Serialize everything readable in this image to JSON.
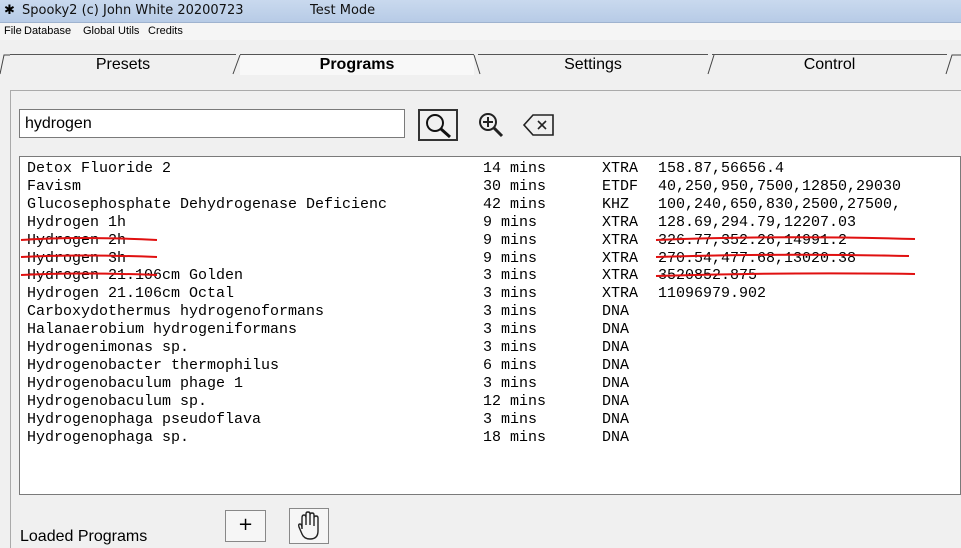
{
  "window": {
    "title": "Spooky2 (c) John White 20200723",
    "mode": "Test Mode"
  },
  "menu": [
    "File",
    "Database",
    "Global",
    "Utils",
    "Credits"
  ],
  "tabs": [
    "Presets",
    "Programs",
    "Settings",
    "Control"
  ],
  "search": {
    "value": "hydrogen"
  },
  "programs": [
    {
      "name": "Detox Fluoride 2",
      "duration": "14 mins",
      "type": "XTRA",
      "freqs": "158.87,56656.4"
    },
    {
      "name": "Favism",
      "duration": "30 mins",
      "type": "ETDF",
      "freqs": "40,250,950,7500,12850,29030"
    },
    {
      "name": "Glucosephosphate Dehydrogenase Deficienc",
      "duration": "42 mins",
      "type": "KHZ",
      "freqs": "100,240,650,830,2500,27500,"
    },
    {
      "name": "Hydrogen 1h",
      "duration": "9 mins",
      "type": "XTRA",
      "freqs": "128.69,294.79,12207.03"
    },
    {
      "name": "Hydrogen 2h",
      "duration": "9 mins",
      "type": "XTRA",
      "freqs": "326.77,352.26,14991.2"
    },
    {
      "name": "Hydrogen 3h",
      "duration": "9 mins",
      "type": "XTRA",
      "freqs": "270.54,477.68,13020.38"
    },
    {
      "name": "Hydrogen 21.106cm Golden",
      "duration": "3 mins",
      "type": "XTRA",
      "freqs": "3520852.875"
    },
    {
      "name": "Hydrogen 21.106cm Octal",
      "duration": "3 mins",
      "type": "XTRA",
      "freqs": "11096979.902"
    },
    {
      "name": "Carboxydothermus hydrogenoformans",
      "duration": "3 mins",
      "type": "DNA",
      "freqs": ""
    },
    {
      "name": "Halanaerobium hydrogeniformans",
      "duration": "3 mins",
      "type": "DNA",
      "freqs": ""
    },
    {
      "name": "Hydrogenimonas sp.",
      "duration": "3 mins",
      "type": "DNA",
      "freqs": ""
    },
    {
      "name": "Hydrogenobacter thermophilus",
      "duration": "6 mins",
      "type": "DNA",
      "freqs": ""
    },
    {
      "name": "Hydrogenobaculum phage 1",
      "duration": "3 mins",
      "type": "DNA",
      "freqs": ""
    },
    {
      "name": "Hydrogenobaculum sp.",
      "duration": "12 mins",
      "type": "DNA",
      "freqs": ""
    },
    {
      "name": "Hydrogenophaga pseudoflava",
      "duration": "3 mins",
      "type": "DNA",
      "freqs": ""
    },
    {
      "name": "Hydrogenophaga sp.",
      "duration": "18 mins",
      "type": "DNA",
      "freqs": ""
    }
  ],
  "bottom": {
    "loaded_label": "Loaded Programs",
    "add_label": "+"
  },
  "colors": {
    "annotation": "#e01010",
    "titlebar": "#c9d9ee"
  }
}
